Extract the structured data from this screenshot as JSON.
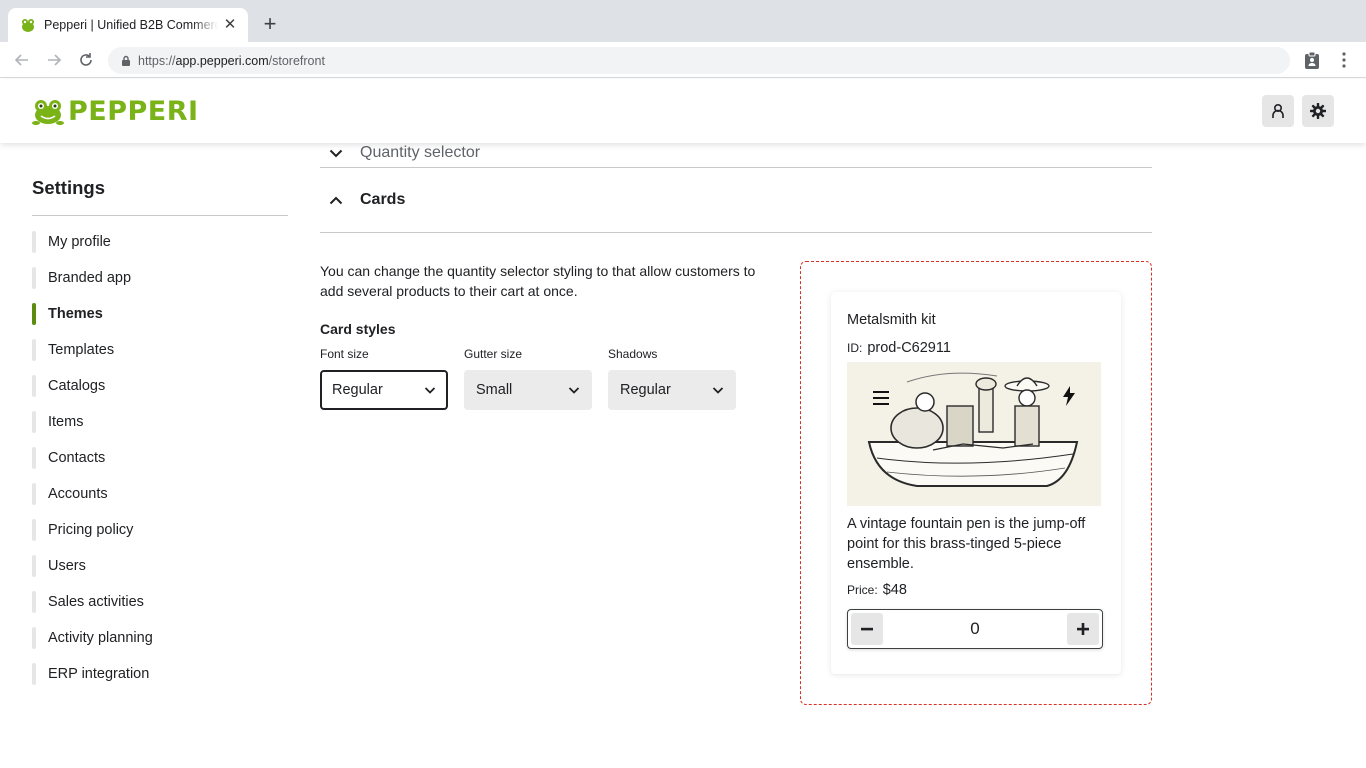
{
  "browser": {
    "tab_title": "Pepperi | Unified B2B Commerce",
    "url_scheme": "https://",
    "url_host": "app.pepperi.com",
    "url_path": "/storefront"
  },
  "header": {
    "logo_text": "PEPPERI",
    "brand_color": "#7ab317"
  },
  "sidebar": {
    "title": "Settings",
    "items": [
      {
        "label": "My profile"
      },
      {
        "label": "Branded app"
      },
      {
        "label": "Themes",
        "active": true
      },
      {
        "label": "Templates"
      },
      {
        "label": "Catalogs"
      },
      {
        "label": "Items"
      },
      {
        "label": "Contacts"
      },
      {
        "label": "Accounts"
      },
      {
        "label": "Pricing policy"
      },
      {
        "label": "Users"
      },
      {
        "label": "Sales activities"
      },
      {
        "label": "Activity planning"
      },
      {
        "label": "ERP integration"
      }
    ]
  },
  "main": {
    "quantity_selector_label": "Quantity selector",
    "cards_label": "Cards",
    "description": "You can change the quantity selector styling to that allow customers to add several products to their cart at once.",
    "card_styles_title": "Card styles",
    "fields": {
      "font_size": {
        "label": "Font size",
        "value": "Regular"
      },
      "gutter_size": {
        "label": "Gutter size",
        "value": "Small"
      },
      "shadows": {
        "label": "Shadows",
        "value": "Regular"
      }
    }
  },
  "preview": {
    "title": "Metalsmith kit",
    "id_label": "ID:",
    "id_value": "prod-C62911",
    "description": "A vintage fountain pen is the jump-off point for this brass-tinged 5-piece ensemble.",
    "price_label": "Price:",
    "price_value": "$48",
    "quantity": "0",
    "border_color": "#d93025"
  }
}
